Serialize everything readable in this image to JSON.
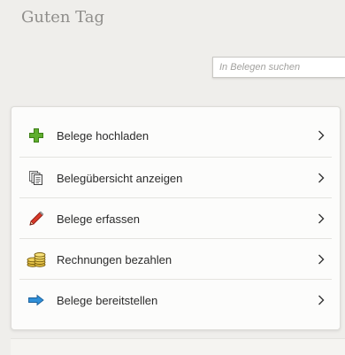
{
  "header": {
    "greeting": "Guten Tag",
    "brand_color": "#1b9aaa"
  },
  "search": {
    "placeholder": "In Belegen suchen",
    "value": ""
  },
  "menu": {
    "items": [
      {
        "label": "Belege hochladen",
        "icon": "plus-icon"
      },
      {
        "label": "Belegübersicht anzeigen",
        "icon": "documents-icon"
      },
      {
        "label": "Belege erfassen",
        "icon": "pencil-icon"
      },
      {
        "label": "Rechnungen bezahlen",
        "icon": "coins-icon"
      },
      {
        "label": "Belege bereitstellen",
        "icon": "arrow-right-icon"
      }
    ]
  }
}
